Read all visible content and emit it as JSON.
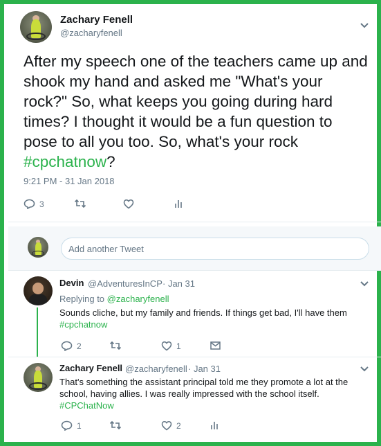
{
  "main_tweet": {
    "name": "Zachary Fenell",
    "handle": "@zacharyfenell",
    "text_before": "After my speech one of the teachers came up and shook my hand and asked me \"What's your rock?\" So, what keeps you going during hard times? I thought it would be a fun question to pose to all you too. So, what's your rock ",
    "hashtag": "#cpchatnow",
    "text_after": "?",
    "timestamp": "9:21 PM - 31 Jan 2018",
    "reply_count": "3"
  },
  "reply_box": {
    "placeholder": "Add another Tweet"
  },
  "replies": [
    {
      "name": "Devin",
      "handle": "@AdventuresInCP",
      "date": "· Jan 31",
      "replying_prefix": "Replying to",
      "replying_to": "@zacharyfenell",
      "text": "Sounds cliche, but my family and friends. If things get bad, I'll have them",
      "hashtag": "#cpchatnow",
      "reply_count": "2",
      "like_count": "1"
    },
    {
      "name": "Zachary Fenell",
      "handle": "@zacharyfenell",
      "date": "· Jan 31",
      "text": "That's something the assistant principal told me they promote a lot at the school, having allies. I was really impressed with the school itself.",
      "hashtag": "#CPChatNow",
      "reply_count": "1",
      "like_count": "2"
    }
  ],
  "colors": {
    "accent": "#2bb24c",
    "text": "#14171a",
    "muted": "#657786",
    "divider": "#e6ecf0"
  },
  "icons": [
    "reply-icon",
    "retweet-icon",
    "like-icon",
    "analytics-icon",
    "message-icon",
    "chevron-down-icon"
  ]
}
